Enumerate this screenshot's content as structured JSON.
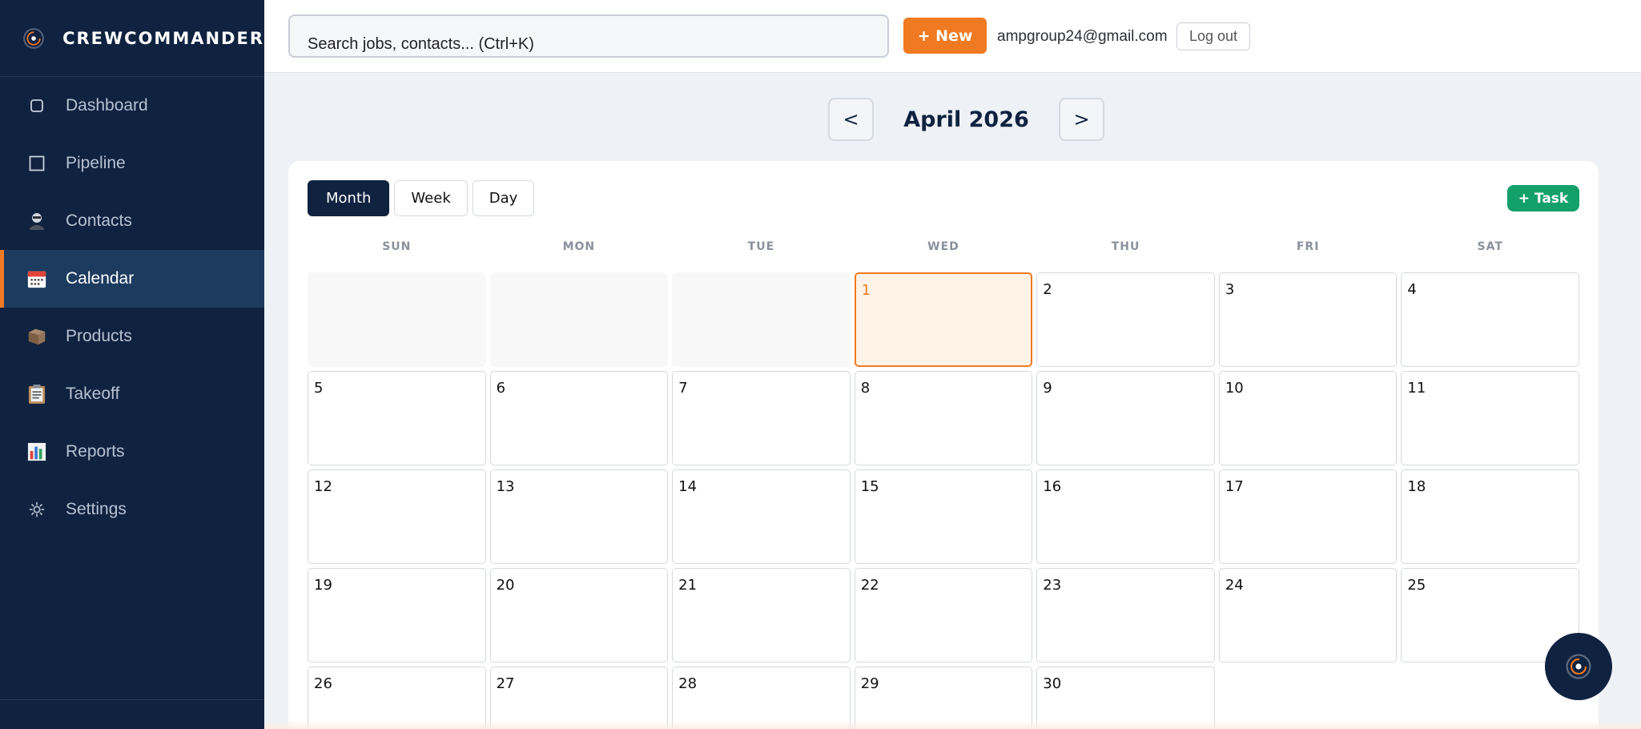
{
  "brand": {
    "name": "CREWCOMMANDER",
    "logo_icon": "concentric-target-logo"
  },
  "sidebar": {
    "items": [
      {
        "label": "Dashboard",
        "icon": "square-outline-icon"
      },
      {
        "label": "Pipeline",
        "icon": "square-outline-icon"
      },
      {
        "label": "Contacts",
        "icon": "person-icon"
      },
      {
        "label": "Calendar",
        "icon": "calendar-icon",
        "active": true
      },
      {
        "label": "Products",
        "icon": "box-icon"
      },
      {
        "label": "Takeoff",
        "icon": "clipboard-icon"
      },
      {
        "label": "Reports",
        "icon": "bar-chart-icon"
      },
      {
        "label": "Settings",
        "icon": "gear-icon"
      }
    ]
  },
  "topbar": {
    "search_placeholder": "Search jobs, contacts... (Ctrl+K)",
    "new_label": "+ New",
    "user_email": "ampgroup24@gmail.com",
    "logout_label": "Log out"
  },
  "calendar": {
    "prev_label": "<",
    "next_label": ">",
    "month_title": "April 2026",
    "views": [
      "Month",
      "Week",
      "Day"
    ],
    "active_view": "Month",
    "task_label": "+ Task",
    "weekdays": [
      "SUN",
      "MON",
      "TUE",
      "WED",
      "THU",
      "FRI",
      "SAT"
    ],
    "leading_blanks": 3,
    "days_in_month": 30,
    "today": 1
  },
  "colors": {
    "sidebar_bg": "#0f2240",
    "accent_orange": "#f07a22",
    "task_green": "#14a06a"
  }
}
